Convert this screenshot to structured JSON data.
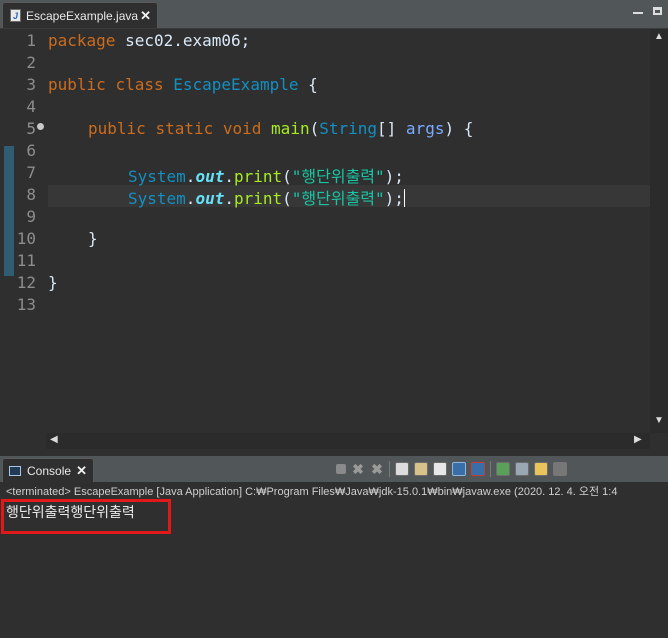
{
  "editor": {
    "tab_title": "EscapeExample.java",
    "tab_close": "✕",
    "line_numbers": [
      "1",
      "2",
      "3",
      "4",
      "5",
      "6",
      "7",
      "8",
      "9",
      "10",
      "11",
      "12",
      "13"
    ],
    "code": {
      "l1_kw": "package",
      "l1_rest": " sec02.exam06;",
      "l3_kw1": "public",
      "l3_kw2": "class",
      "l3_cls": "EscapeExample",
      "l3_brace": " {",
      "l5_kw1": "public",
      "l5_kw2": "static",
      "l5_kw3": "void",
      "l5_mth": "main",
      "l5_open": "(",
      "l5_type": "String",
      "l5_arr": "[] ",
      "l5_param": "args",
      "l5_close": ") {",
      "l7_cls": "System",
      "l7_dot1": ".",
      "l7_fld": "out",
      "l7_dot2": ".",
      "l7_mth": "print",
      "l7_open": "(",
      "l7_str": "\"행단위출력\"",
      "l7_close": ");",
      "l8_cls": "System",
      "l8_dot1": ".",
      "l8_fld": "out",
      "l8_dot2": ".",
      "l8_mth": "print",
      "l8_open": "(",
      "l8_str": "\"행단위출력\"",
      "l8_close": ");",
      "l10": "}",
      "l12": "}"
    }
  },
  "console": {
    "tab_title": "Console",
    "tab_close": "✕",
    "info": "<terminated> EscapeExample [Java Application] C:₩Program Files₩Java₩jdk-15.0.1₩bin₩javaw.exe  (2020. 12. 4. 오전 1:4",
    "output": "행단위출력행단위출력"
  },
  "colors": {
    "keyword": "#cc6c1d",
    "class": "#1290c3",
    "string": "#17c6a3",
    "method": "#a7ec21",
    "highlight": "#e01818"
  }
}
